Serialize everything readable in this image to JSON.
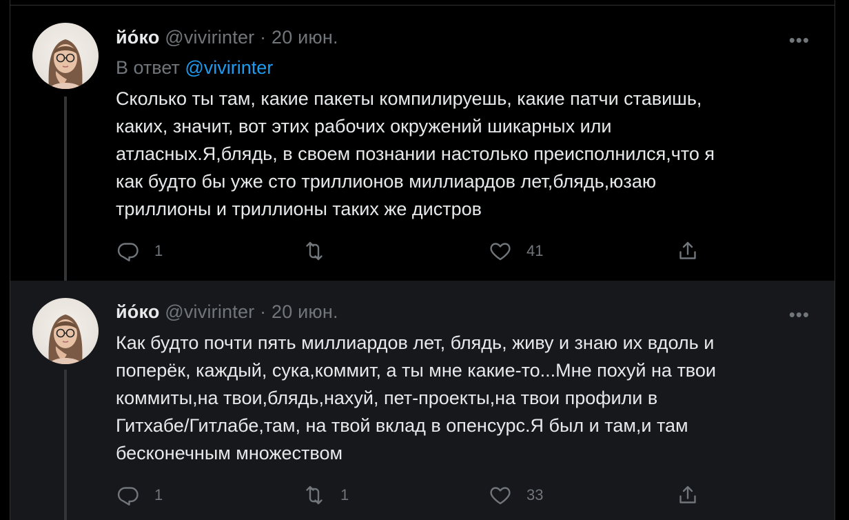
{
  "tweets": [
    {
      "name": "йо́ко",
      "handle": "@vivirinter",
      "dot": "·",
      "date": "20 июн.",
      "more_label": "•••",
      "reply_prefix": "В ответ",
      "reply_mention": "@vivirinter",
      "lines": [
        "Сколько ты там, какие пакеты компилируешь, какие патчи ставишь,",
        "каких, значит, вот этих рабочих окружений шикарных или",
        "атласных.Я,блядь, в своем познании настолько преисполнился,что я",
        "как будто бы уже сто триллионов миллиардов лет,блядь,юзаю",
        "триллионы и триллионы таких же дистров"
      ],
      "actions": {
        "replies": "1",
        "retweets": "",
        "likes": "41"
      }
    },
    {
      "name": "йо́ко",
      "handle": "@vivirinter",
      "dot": "·",
      "date": "20 июн.",
      "more_label": "•••",
      "lines": [
        "Как будто почти пять миллиардов лет, блядь, живу и знаю их вдоль и",
        "поперёк, каждый, сука,коммит, а ты мне какие-то...Мне похуй на твои",
        "коммиты,на твои,блядь,нахуй, пет-проекты,на твои профили в",
        "Гитхабе/Гитлабе,там, на твой вклад в опенсурс.Я был и там,и там",
        "бесконечным множеством"
      ],
      "actions": {
        "replies": "1",
        "retweets": "1",
        "likes": "33"
      }
    }
  ],
  "icons": [
    "reply-icon",
    "retweet-icon",
    "like-icon",
    "share-icon",
    "more-icon"
  ],
  "colors": {
    "background": "#000000",
    "highlight": "#16181c",
    "mention": "#1d9bf0",
    "muted": "#71767b"
  }
}
